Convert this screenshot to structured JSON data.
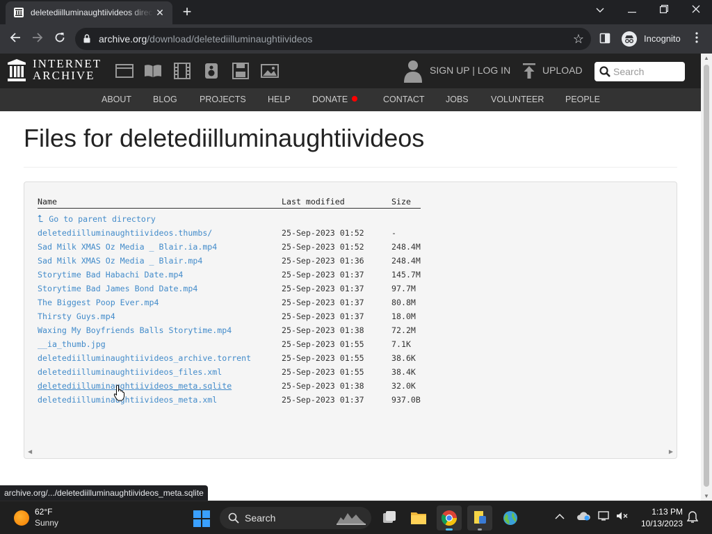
{
  "browser": {
    "tab_title": "deletediilluminaughtiivideos directory listing",
    "tab_close": "✕",
    "new_tab": "+",
    "url_host": "archive.org",
    "url_path": "/download/deletediilluminaughtiivideos",
    "incognito_label": "Incognito",
    "status_url": "archive.org/.../deletediilluminaughtiivideos_meta.sqlite"
  },
  "ia_header": {
    "wordmark_line1": "INTERNET",
    "wordmark_line2": "ARCHIVE",
    "signin_label": "SIGN UP | LOG IN",
    "upload_label": "UPLOAD",
    "search_placeholder": "Search",
    "nav": [
      "ABOUT",
      "BLOG",
      "PROJECTS",
      "HELP",
      "DONATE",
      "CONTACT",
      "JOBS",
      "VOLUNTEER",
      "PEOPLE"
    ]
  },
  "page": {
    "title": "Files for deletediilluminaughtiivideos",
    "columns": {
      "name": "Name",
      "modified": "Last modified",
      "size": "Size"
    },
    "parent_link": "Go to parent directory",
    "files": [
      {
        "name": "deletediilluminaughtiivideos.thumbs/",
        "modified": "25-Sep-2023 01:52",
        "size": "-"
      },
      {
        "name": "Sad Milk XMAS Oz Media _ Blair.ia.mp4",
        "modified": "25-Sep-2023 01:52",
        "size": "248.4M"
      },
      {
        "name": "Sad Milk XMAS Oz Media _ Blair.mp4",
        "modified": "25-Sep-2023 01:36",
        "size": "248.4M"
      },
      {
        "name": "Storytime Bad Habachi Date.mp4",
        "modified": "25-Sep-2023 01:37",
        "size": "145.7M"
      },
      {
        "name": "Storytime Bad James Bond Date.mp4",
        "modified": "25-Sep-2023 01:37",
        "size": "97.7M"
      },
      {
        "name": "The Biggest Poop Ever.mp4",
        "modified": "25-Sep-2023 01:37",
        "size": "80.8M"
      },
      {
        "name": "Thirsty Guys.mp4",
        "modified": "25-Sep-2023 01:37",
        "size": "18.0M"
      },
      {
        "name": "Waxing My Boyfriends Balls Storytime.mp4",
        "modified": "25-Sep-2023 01:38",
        "size": "72.2M"
      },
      {
        "name": "__ia_thumb.jpg",
        "modified": "25-Sep-2023 01:55",
        "size": "7.1K"
      },
      {
        "name": "deletediilluminaughtiivideos_archive.torrent",
        "modified": "25-Sep-2023 01:55",
        "size": "38.6K"
      },
      {
        "name": "deletediilluminaughtiivideos_files.xml",
        "modified": "25-Sep-2023 01:55",
        "size": "38.4K"
      },
      {
        "name": "deletediilluminaughtiivideos_meta.sqlite",
        "modified": "25-Sep-2023 01:38",
        "size": "32.0K"
      },
      {
        "name": "deletediilluminaughtiivideos_meta.xml",
        "modified": "25-Sep-2023 01:37",
        "size": "937.0B"
      }
    ]
  },
  "taskbar": {
    "temperature": "62°F",
    "condition": "Sunny",
    "search_label": "Search",
    "time": "1:13 PM",
    "date": "10/13/2023"
  },
  "colors": {
    "link": "#428bca",
    "ia_header": "#222222",
    "ia_nav": "#333333",
    "donate_dot": "#ff0000"
  }
}
